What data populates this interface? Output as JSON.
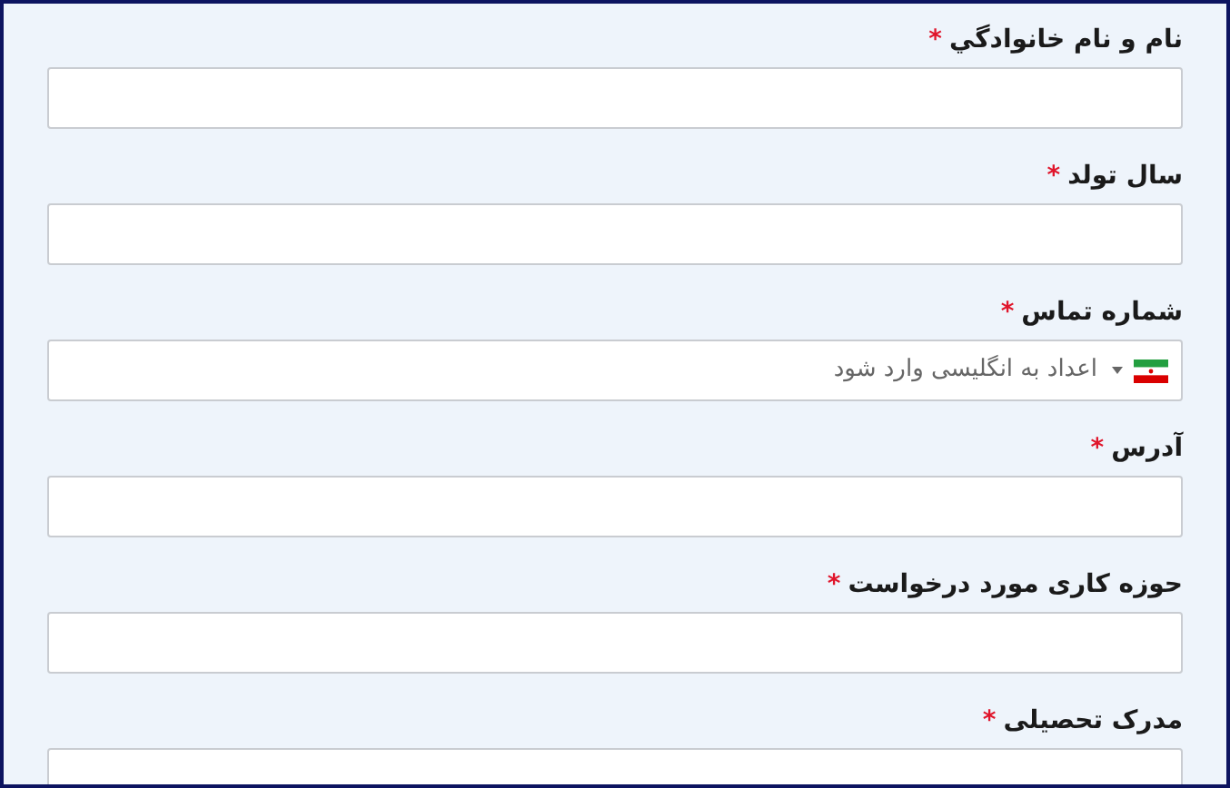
{
  "fields": [
    {
      "kind": "text",
      "label": "نام و نام خانوادگي",
      "required_mark": "*"
    },
    {
      "kind": "text",
      "label": "سال تولد",
      "required_mark": "*"
    },
    {
      "kind": "phone",
      "label": "شماره تماس",
      "required_mark": "*",
      "placeholder": "اعداد به انگلیسی وارد شود"
    },
    {
      "kind": "text",
      "label": "آدرس",
      "required_mark": "*"
    },
    {
      "kind": "text",
      "label": "حوزه کاری مورد درخواست",
      "required_mark": "*"
    },
    {
      "kind": "text",
      "label": "مدرک تحصیلی",
      "required_mark": "*"
    }
  ]
}
